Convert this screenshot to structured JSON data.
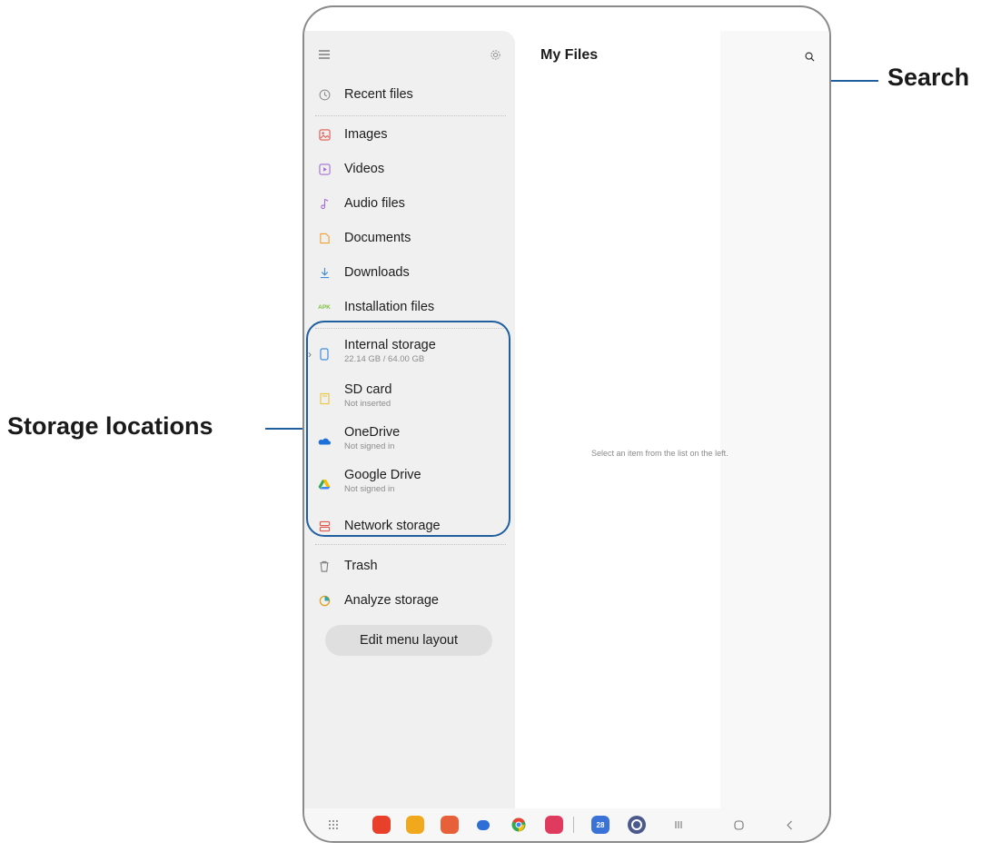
{
  "app": {
    "title": "My Files",
    "empty_message": "Select an item from the list on the left."
  },
  "drawer": {
    "menu_icon": "hamburger-icon",
    "settings_icon": "gear-icon",
    "recent": {
      "label": "Recent files",
      "icon": "clock-icon"
    },
    "categories": [
      {
        "label": "Images",
        "icon": "image-icon",
        "color": "#e2574c"
      },
      {
        "label": "Videos",
        "icon": "video-icon",
        "color": "#a66dd4"
      },
      {
        "label": "Audio files",
        "icon": "music-note-icon",
        "color": "#a66dd4"
      },
      {
        "label": "Documents",
        "icon": "document-icon",
        "color": "#f0a030"
      },
      {
        "label": "Downloads",
        "icon": "download-icon",
        "color": "#3f8ede"
      },
      {
        "label": "Installation files",
        "icon": "apk-icon",
        "icon_text": "APK",
        "color": "#7cbf3a"
      }
    ],
    "storage": [
      {
        "label": "Internal storage",
        "sub": "22.14 GB / 64.00 GB",
        "icon": "phone-icon",
        "color": "#3f8ede"
      },
      {
        "label": "SD card",
        "sub": "Not inserted",
        "icon": "sd-card-icon",
        "color": "#e8c94a"
      },
      {
        "label": "OneDrive",
        "sub": "Not signed in",
        "icon": "onedrive-icon",
        "color": "#1e6fd9"
      },
      {
        "label": "Google Drive",
        "sub": "Not signed in",
        "icon": "google-drive-icon",
        "color": "#34a853"
      },
      {
        "label": "Network storage",
        "icon": "server-icon",
        "color": "#e2574c"
      }
    ],
    "tools": [
      {
        "label": "Trash",
        "icon": "trash-icon",
        "color": "#666666"
      },
      {
        "label": "Analyze storage",
        "icon": "analyze-storage-icon",
        "color": "#e0a020"
      }
    ],
    "edit_button": "Edit menu layout"
  },
  "callouts": {
    "search": "Search",
    "storage": "Storage locations",
    "accent": "#1f5fa0"
  },
  "navbar": {
    "apps": [
      "apps-grid-icon",
      "app-icon-1",
      "folder-app-icon",
      "contacts-app-icon",
      "messages-app-icon",
      "chrome-app-icon",
      "camera-app-icon",
      "calendar-app-icon",
      "settings-app-icon"
    ],
    "calendar_day": "28",
    "keys": [
      "recents-key",
      "home-key",
      "back-key"
    ]
  }
}
